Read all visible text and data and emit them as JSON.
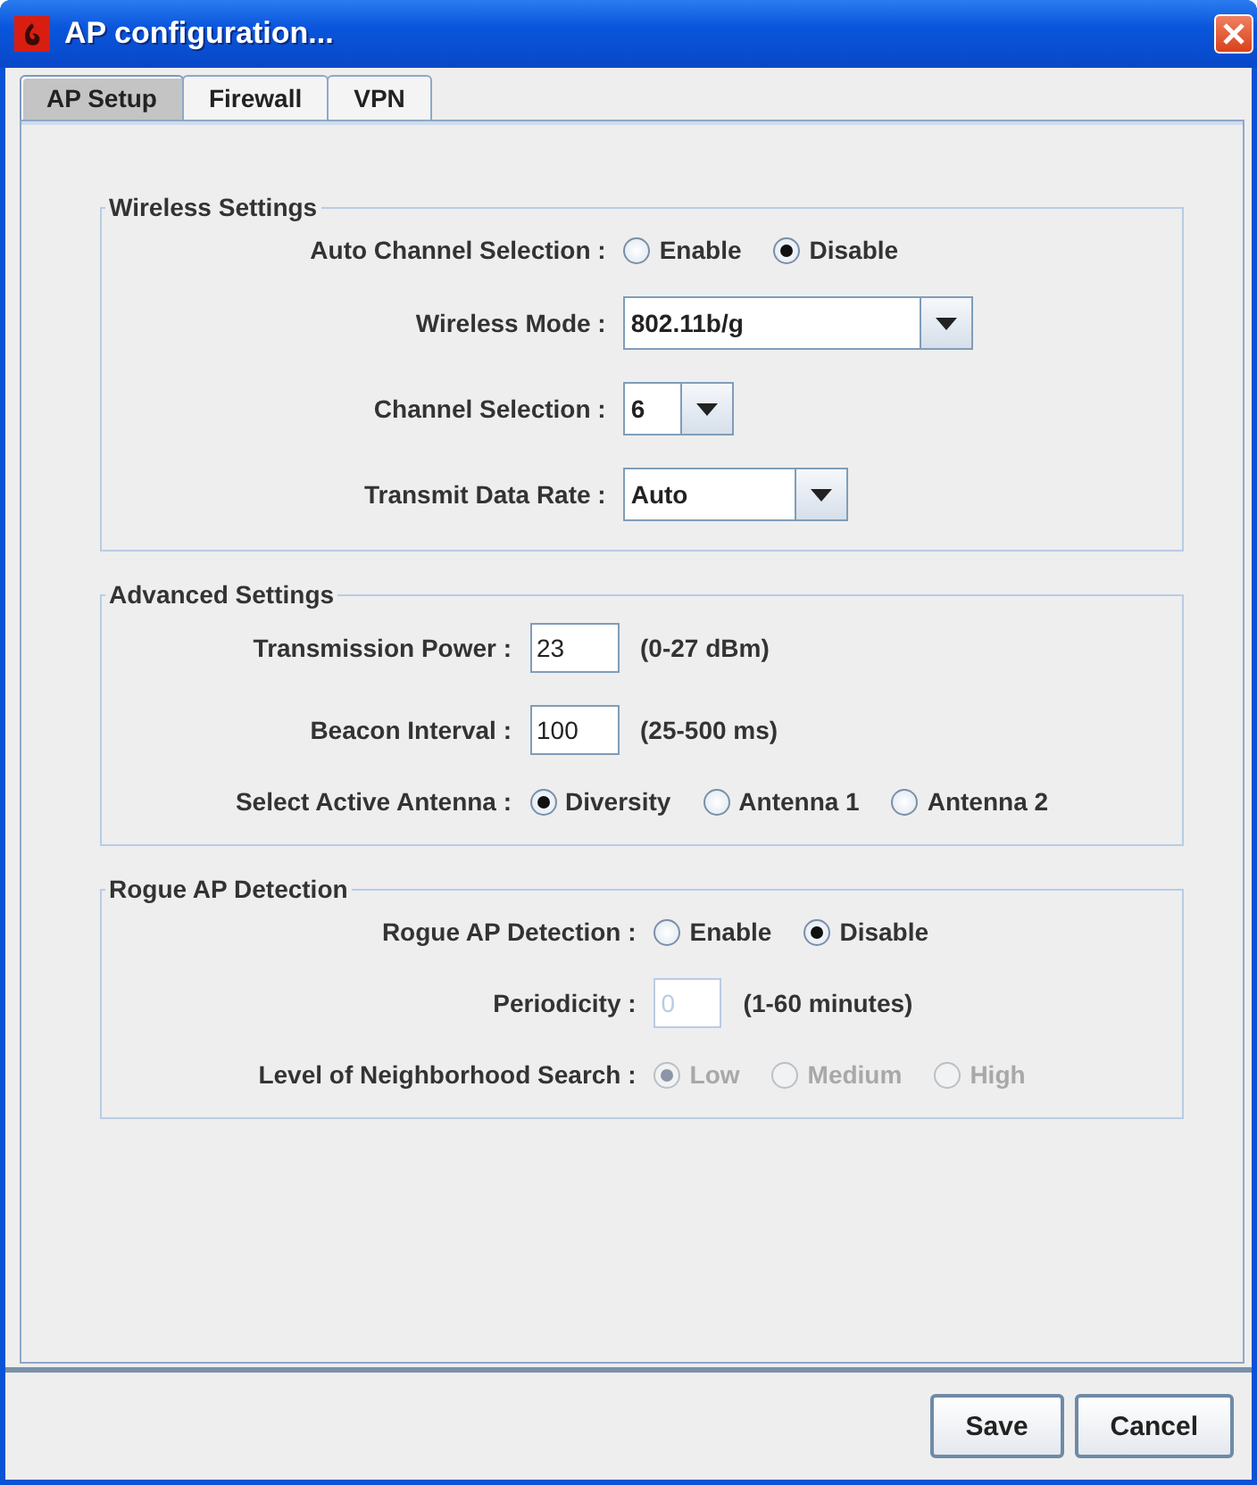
{
  "window": {
    "title": "AP configuration..."
  },
  "tabs": [
    {
      "label": "AP Setup",
      "selected": true
    },
    {
      "label": "Firewall",
      "selected": false
    },
    {
      "label": "VPN",
      "selected": false
    }
  ],
  "sections": [
    {
      "title": "Wireless Settings",
      "rows": [
        {
          "kind": "radio",
          "label": "Auto Channel Selection :",
          "disabled": false,
          "options": [
            {
              "label": "Enable",
              "selected": false
            },
            {
              "label": "Disable",
              "selected": true
            }
          ]
        },
        {
          "kind": "combo",
          "label": "Wireless Mode :",
          "value": "802.11b/g"
        },
        {
          "kind": "combo",
          "label": "Channel Selection :",
          "value": "6"
        },
        {
          "kind": "combo",
          "label": "Transmit Data Rate :",
          "value": "Auto"
        }
      ]
    },
    {
      "title": "Advanced Settings",
      "rows": [
        {
          "kind": "text",
          "label": "Transmission Power :",
          "value": "23",
          "hint": "(0-27 dBm)",
          "disabled": false
        },
        {
          "kind": "text",
          "label": "Beacon Interval :",
          "value": "100",
          "hint": "(25-500 ms)",
          "disabled": false
        },
        {
          "kind": "radio",
          "label": "Select Active Antenna :",
          "disabled": false,
          "options": [
            {
              "label": "Diversity",
              "selected": true
            },
            {
              "label": "Antenna 1",
              "selected": false
            },
            {
              "label": "Antenna 2",
              "selected": false
            }
          ]
        }
      ]
    },
    {
      "title": "Rogue AP Detection",
      "rows": [
        {
          "kind": "radio",
          "label": "Rogue AP Detection :",
          "disabled": false,
          "options": [
            {
              "label": "Enable",
              "selected": false
            },
            {
              "label": "Disable",
              "selected": true
            }
          ]
        },
        {
          "kind": "text",
          "label": "Periodicity :",
          "value": "0",
          "hint": "(1-60 minutes)",
          "disabled": true
        },
        {
          "kind": "radio",
          "label": "Level of Neighborhood Search :",
          "disabled": true,
          "options": [
            {
              "label": "Low",
              "selected": true
            },
            {
              "label": "Medium",
              "selected": false
            },
            {
              "label": "High",
              "selected": false
            }
          ]
        }
      ]
    }
  ],
  "buttons": [
    "Save",
    "Cancel"
  ]
}
